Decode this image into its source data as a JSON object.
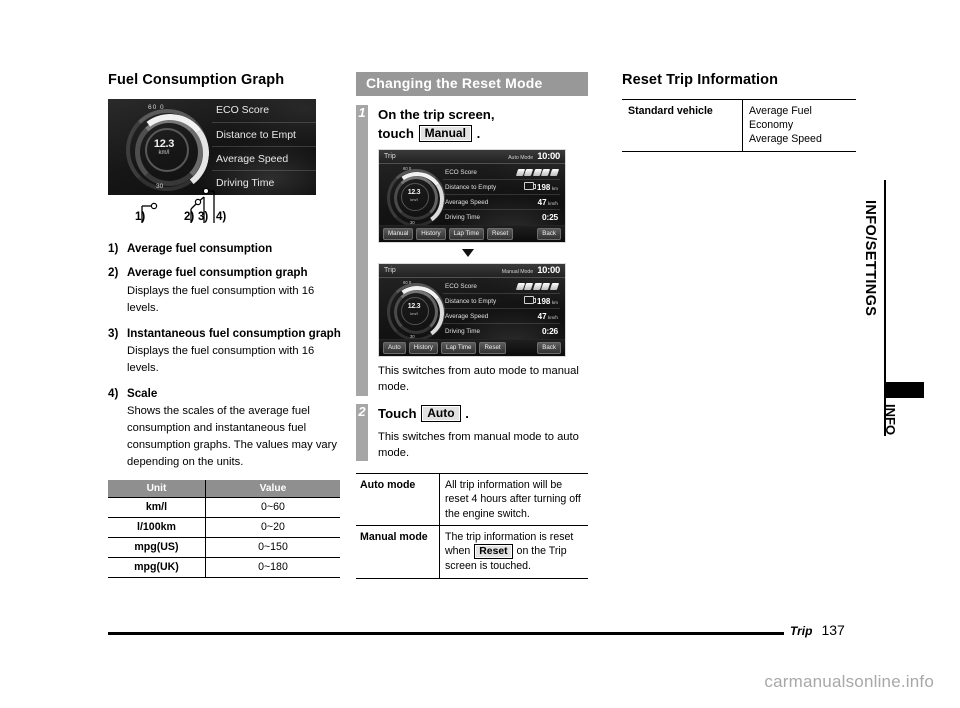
{
  "page": {
    "footer_section": "Trip",
    "footer_page": "137",
    "watermark": "carmanualsonline.info"
  },
  "side_tab": {
    "label": "INFO/SETTINGS",
    "sub_label": "INFO"
  },
  "left_column": {
    "heading": "Fuel Consumption Graph",
    "illustration": {
      "gauge_value": "12.3",
      "gauge_unit": "km/l",
      "scale_top": "60 0",
      "scale_bottom": "30",
      "menu_rows": [
        "ECO Score",
        "Distance to Empt",
        "Average Speed",
        "Driving Time"
      ],
      "callouts": [
        "1)",
        "2)",
        "3)",
        "4)"
      ]
    },
    "items": [
      {
        "marker": "1)",
        "title": "Average fuel consumption",
        "body": ""
      },
      {
        "marker": "2)",
        "title": "Average fuel consumption graph",
        "body": "Displays the fuel consumption with 16 levels."
      },
      {
        "marker": "3)",
        "title": "Instantaneous fuel consumption graph",
        "body": "Displays the fuel consumption with 16 levels."
      },
      {
        "marker": "4)",
        "title": "Scale",
        "body": "Shows the scales of the average fuel consumption and instantaneous fuel consumption graphs. The values may vary depending on the units."
      }
    ],
    "scale_table": {
      "headers": [
        "Unit",
        "Value"
      ],
      "rows": [
        [
          "km/l",
          "0~60"
        ],
        [
          "l/100km",
          "0~20"
        ],
        [
          "mpg(US)",
          "0~150"
        ],
        [
          "mpg(UK)",
          "0~180"
        ]
      ]
    }
  },
  "mid_column": {
    "heading": "Changing the Reset Mode",
    "step1": {
      "number": "1",
      "title_line1": "On the trip screen,",
      "title_line2_prefix": "touch",
      "title_key": "Manual",
      "title_line2_suffix": ".",
      "result_text": "This switches from auto mode to manual mode."
    },
    "step2": {
      "number": "2",
      "title_prefix": "Touch",
      "title_key": "Auto",
      "title_suffix": ".",
      "result_text": "This switches from manual mode to auto mode."
    },
    "trip_screen_before": {
      "title": "Trip",
      "mode": "Auto Mode",
      "clock": "10:00",
      "gauge_value": "12.3",
      "gauge_unit": "km/l",
      "scale_top": "60 0",
      "scale_bottom": "30",
      "rows": [
        {
          "label": "ECO Score",
          "value": "",
          "unit": "",
          "kind": "flags"
        },
        {
          "label": "Distance to Empty",
          "value": "198",
          "unit": "km",
          "kind": "fuel"
        },
        {
          "label": "Average Speed",
          "value": "47",
          "unit": "km/h",
          "kind": "value"
        },
        {
          "label": "Driving Time",
          "value": "0:25",
          "unit": "",
          "kind": "time"
        }
      ],
      "buttons": [
        "Manual",
        "History",
        "Lap Time",
        "Reset"
      ],
      "back_button": "Back"
    },
    "trip_screen_after": {
      "title": "Trip",
      "mode": "Manual Mode",
      "clock": "10:00",
      "gauge_value": "12.3",
      "gauge_unit": "km/l",
      "scale_top": "60 0",
      "scale_bottom": "30",
      "rows": [
        {
          "label": "ECO Score",
          "value": "",
          "unit": "",
          "kind": "flags"
        },
        {
          "label": "Distance to Empty",
          "value": "198",
          "unit": "km",
          "kind": "fuel"
        },
        {
          "label": "Average Speed",
          "value": "47",
          "unit": "km/h",
          "kind": "value"
        },
        {
          "label": "Driving Time",
          "value": "0:26",
          "unit": "",
          "kind": "time"
        }
      ],
      "buttons": [
        "Auto",
        "History",
        "Lap Time",
        "Reset"
      ],
      "back_button": "Back"
    },
    "mode_table": {
      "auto_key": "Auto mode",
      "auto_value": "All trip information will be reset 4 hours after turning off the engine switch.",
      "manual_key": "Manual mode",
      "manual_value_pre": "The trip information is reset when",
      "manual_value_key": "Reset",
      "manual_value_post": "on the Trip screen is touched."
    }
  },
  "right_column": {
    "heading": "Reset Trip Information",
    "table": {
      "key": "Standard vehicle",
      "value_line1": "Average Fuel Economy",
      "value_line2": "Average Speed"
    }
  }
}
